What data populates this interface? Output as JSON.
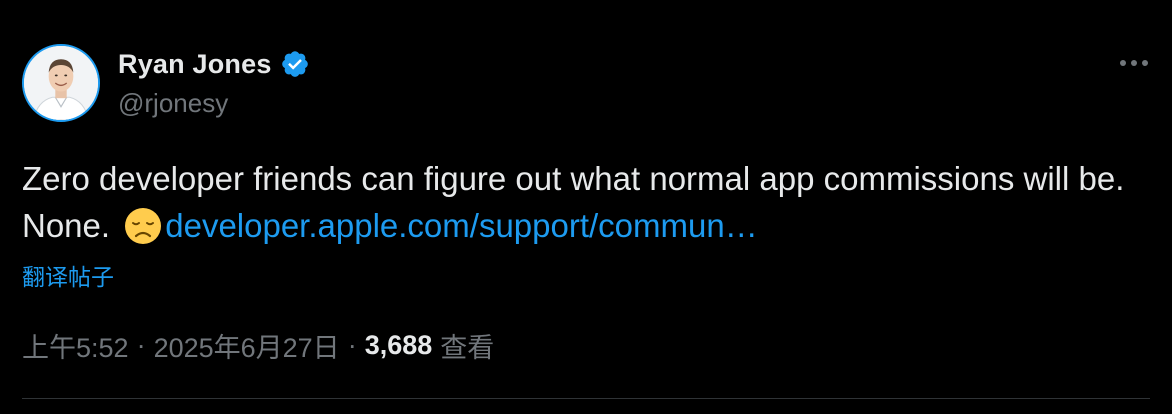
{
  "author": {
    "display_name": "Ryan Jones",
    "handle": "@rjonesy",
    "verified": true,
    "avatar_icon": "avatar-photo"
  },
  "tweet": {
    "text_before_link": "Zero developer friends can figure out what normal app commissions will be. None. ",
    "emoji": "disappointed-face",
    "link_text": "developer.apple.com/support/commun…",
    "translate_label": "翻译帖子"
  },
  "meta": {
    "time": "上午5:52",
    "separator": "·",
    "date": "2025年6月27日",
    "views_count": "3,688",
    "views_label": "查看"
  },
  "colors": {
    "background": "#000000",
    "text": "#e7e9ea",
    "secondary": "#71767b",
    "accent": "#1d9bf0",
    "divider": "#2f3336"
  },
  "icons": {
    "verified": "verified-badge-icon",
    "more": "more-options-icon"
  }
}
